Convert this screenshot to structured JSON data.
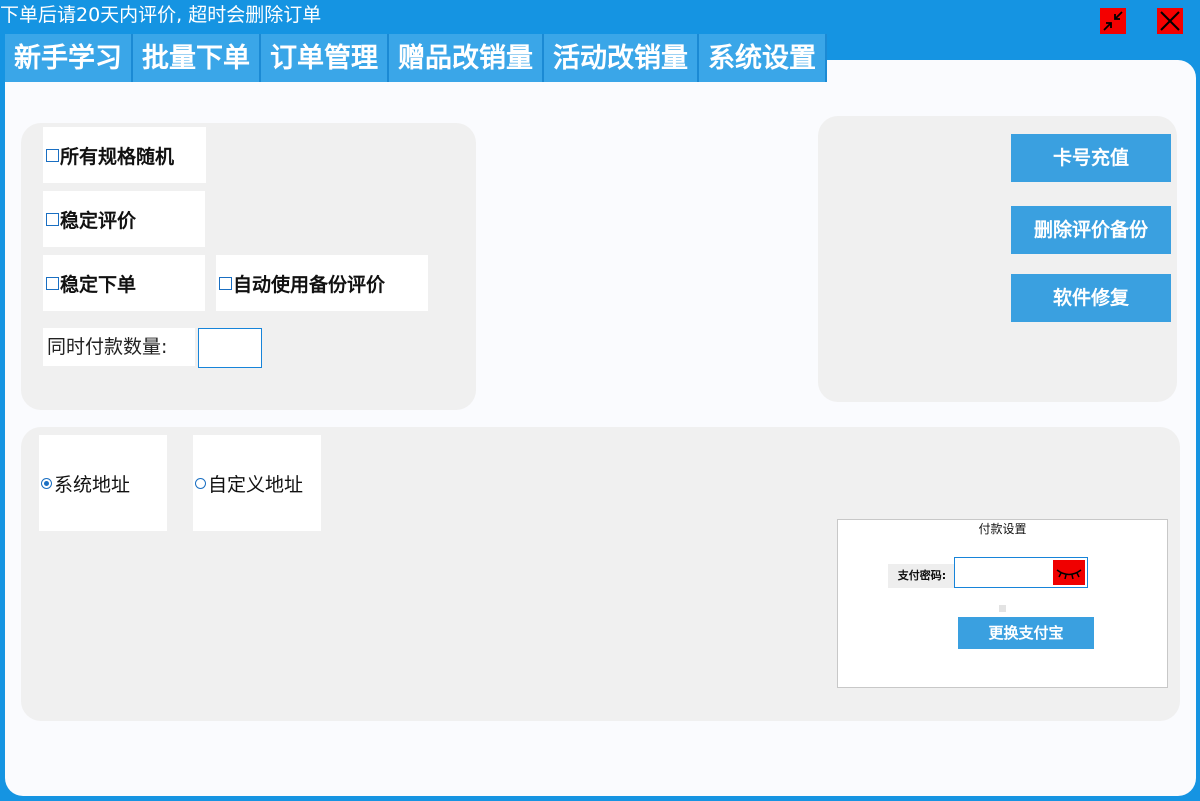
{
  "window": {
    "title": "下单后请20天内评价, 超时会删除订单",
    "minimize_icon": "shrink-arrows-icon",
    "close_icon": "close-x-icon",
    "button_color": "#f40000"
  },
  "tabs": [
    {
      "label": "新手学习"
    },
    {
      "label": "批量下单"
    },
    {
      "label": "订单管理"
    },
    {
      "label": "赠品改销量"
    },
    {
      "label": "活动改销量"
    },
    {
      "label": "系统设置"
    }
  ],
  "options": {
    "random_spec": "所有规格随机",
    "stable_review": "稳定评价",
    "stable_order": "稳定下单",
    "auto_backup_review": "自动使用备份评价",
    "checked": {
      "random_spec": false,
      "stable_review": false,
      "stable_order": false,
      "auto_backup_review": false
    },
    "concurrent_pay_label": "同时付款数量:",
    "concurrent_pay_value": ""
  },
  "actions": {
    "recharge": "卡号充值",
    "delete_backup": "删除评价备份",
    "repair": "软件修复"
  },
  "address": {
    "system": "系统地址",
    "custom": "自定义地址",
    "selected": "system"
  },
  "payment": {
    "legend": "付款设置",
    "password_label": "支付密码:",
    "password_value": "",
    "eye_icon": "eye-closed-icon",
    "change_alipay": "更换支付宝"
  },
  "colors": {
    "primary": "#1594e2",
    "button": "#3aa0e0",
    "tab": "#3aa6e8",
    "panel": "#f0f0f0"
  }
}
